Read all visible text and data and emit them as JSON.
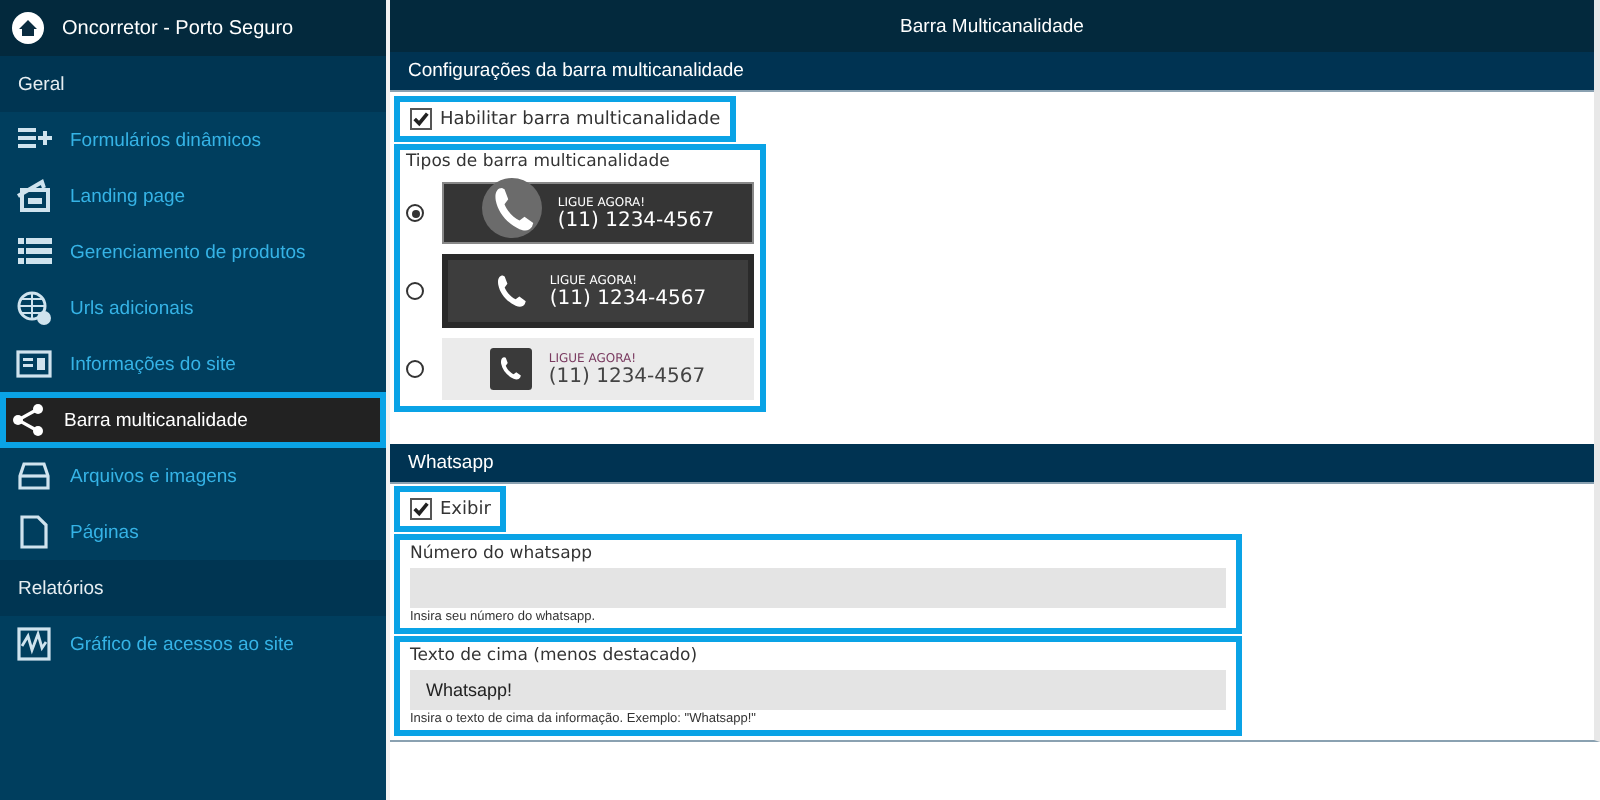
{
  "app": {
    "title": "Oncorretor - Porto Seguro"
  },
  "sidebar": {
    "sections": [
      {
        "heading": "Geral",
        "items": [
          {
            "label": "Formulários dinâmicos",
            "selected": false,
            "highlighted": false
          },
          {
            "label": "Landing page",
            "selected": false,
            "highlighted": false
          },
          {
            "label": "Gerenciamento de produtos",
            "selected": false,
            "highlighted": false
          },
          {
            "label": "Urls adicionais",
            "selected": false,
            "highlighted": false
          },
          {
            "label": "Informações do site",
            "selected": false,
            "highlighted": false
          },
          {
            "label": "Barra multicanalidade",
            "selected": true,
            "highlighted": true
          },
          {
            "label": "Arquivos e imagens",
            "selected": false,
            "highlighted": false
          },
          {
            "label": "Páginas",
            "selected": false,
            "highlighted": false
          }
        ]
      },
      {
        "heading": "Relatórios",
        "items": [
          {
            "label": "Gráfico de acessos ao site",
            "selected": false,
            "highlighted": false
          }
        ]
      }
    ]
  },
  "page": {
    "title": "Barra Multicanalidade"
  },
  "bar_config": {
    "heading": "Configurações da barra multicanalidade",
    "enable": {
      "label": "Habilitar barra multicanalidade",
      "checked": true,
      "highlighted": true
    },
    "types": {
      "label": "Tipos de barra multicanalidade",
      "highlighted": true,
      "options": [
        {
          "kind": "round",
          "selected": true,
          "caption": "LIGUE AGORA!",
          "phone": "(11) 1234-4567"
        },
        {
          "kind": "framed",
          "selected": false,
          "caption": "LIGUE AGORA!",
          "phone": "(11) 1234-4567"
        },
        {
          "kind": "light",
          "selected": false,
          "caption": "LIGUE AGORA!",
          "phone": "(11) 1234-4567"
        }
      ]
    }
  },
  "whatsapp": {
    "heading": "Whatsapp",
    "show": {
      "label": "Exibir",
      "checked": true,
      "highlighted": true
    },
    "fields": [
      {
        "label": "Número do whatsapp",
        "help": "Insira seu número do whatsapp.",
        "highlighted": true
      },
      {
        "label": "Texto de cima (menos destacado)",
        "value": "Whatsapp!",
        "help": "Insira o texto de cima da informação. Exemplo: \"Whatsapp!\"",
        "highlighted": true
      }
    ]
  }
}
